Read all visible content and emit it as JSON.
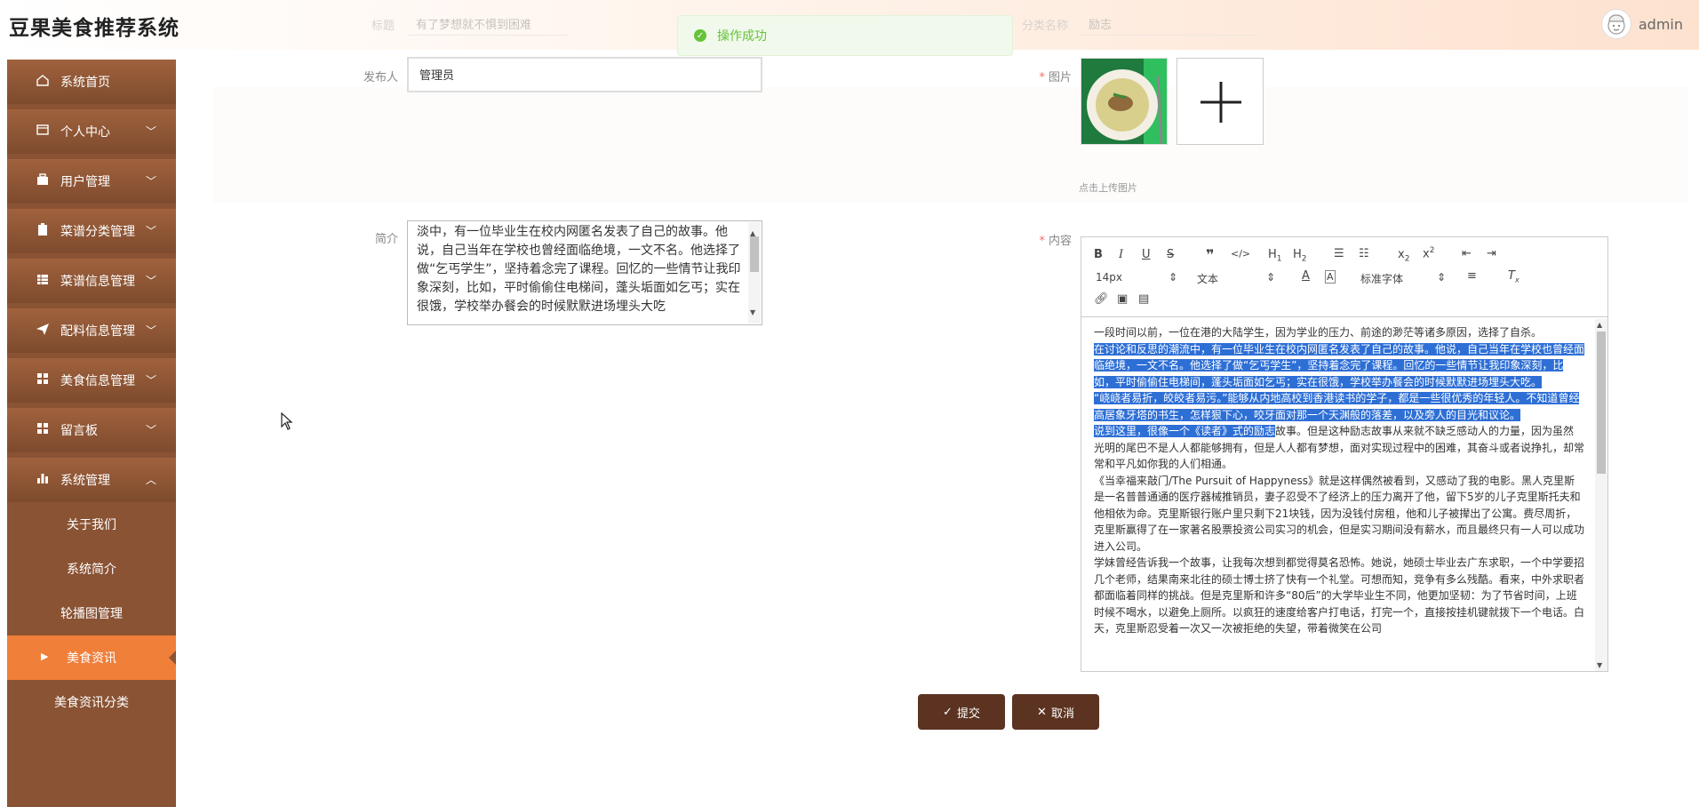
{
  "app": {
    "title": "豆果美食推荐系统"
  },
  "header": {
    "ghost_left_label": "标题",
    "ghost_left_value": "有了梦想就不惧到困难",
    "ghost_right_label": "分类名称",
    "ghost_right_value": "励志"
  },
  "user": {
    "name": "admin",
    "avatar_icon": "chef-avatar-icon"
  },
  "toast": {
    "text": "操作成功",
    "color": "#67c23a"
  },
  "sidebar": {
    "items": [
      {
        "label": "系统首页",
        "icon": "home-icon"
      },
      {
        "label": "个人中心",
        "icon": "wallet-icon"
      },
      {
        "label": "用户管理",
        "icon": "briefcase-icon"
      },
      {
        "label": "菜谱分类管理",
        "icon": "clipboard-icon"
      },
      {
        "label": "菜谱信息管理",
        "icon": "grid-icon"
      },
      {
        "label": "配料信息管理",
        "icon": "send-icon"
      },
      {
        "label": "美食信息管理",
        "icon": "dashboard-icon"
      },
      {
        "label": "留言板",
        "icon": "dashboard-icon"
      },
      {
        "label": "系统管理",
        "icon": "chart-icon"
      }
    ],
    "sub_items": [
      {
        "label": "关于我们"
      },
      {
        "label": "系统简介"
      },
      {
        "label": "轮播图管理"
      },
      {
        "label": "美食资讯"
      },
      {
        "label": "美食资讯分类"
      }
    ],
    "accent": "#f07f3a"
  },
  "form": {
    "publisher_label": "发布人",
    "publisher_value": "管理员",
    "image_label": "图片",
    "upload_tip": "点击上传图片",
    "intro_label": "简介",
    "intro_value": "淡中，有一位毕业生在校内网匿名发表了自己的故事。他说，自己当年在学校也曾经面临绝境，一文不名。他选择了做“乞丐学生”，坚持着念完了课程。回忆的一些情节让我印象深刻，比如，平时偷偷住电梯间，蓬头垢面如乞丐；实在很饿，学校举办餐会的时候默默进场埋头大吃",
    "content_label": "内容"
  },
  "editor": {
    "font_size": "14px",
    "para_type": "文本",
    "font_family": "标准字体",
    "lines": [
      {
        "text": "一段时间以前，一位在港的大陆学生，因为学业的压力、前途的渺茫等诸多原因，选择了自杀。",
        "hl": false
      },
      {
        "text": "在讨论和反思的潮流中，有一位毕业生在校内网匿名发表了自己的故事。他说，自己当年在学校也曾经面临绝境，一文不名。他选择了做“乞丐学生”，坚持着念完了课程。回忆的一些情节让我印象深刻，比如，平时偷偷住电梯间，蓬头垢面如乞丐；实在很饿，学校举办餐会的时候默默进场埋头大吃。",
        "hl": true
      },
      {
        "text": "“峣峣者易折，皎皎者易污。”能够从内地高校到香港读书的学子，都是一些很优秀的年轻人。不知道曾经高居象牙塔的书生，怎样狠下心，咬牙面对那一个天渊般的落差，以及旁人的目光和议论。",
        "hl": true
      },
      {
        "text_hl": "说到这里，很像一个《读者》式的励志",
        "text": "故事。但是这种励志故事从来就不缺乏感动人的力量，因为虽然光明的尾巴不是人人都能够拥有，但是人人都有梦想，面对实现过程中的困难，其奋斗或者说挣扎，却常常和平凡如你我的人们相通。",
        "split": true
      },
      {
        "text": "《当幸福来敲门/The Pursuit of Happyness》就是这样偶然被看到，又感动了我的电影。黑人克里斯是一名普普通通的医疗器械推销员，妻子忍受不了经济上的压力离开了他，留下5岁的儿子克里斯托夫和他相依为命。克里斯银行账户里只剩下21块钱，因为没钱付房租，他和儿子被撵出了公寓。费尽周折，克里斯赢得了在一家著名股票投资公司实习的机会，但是实习期间没有薪水，而且最终只有一人可以成功进入公司。",
        "hl": false
      },
      {
        "text": "学妹曾经告诉我一个故事，让我每次想到都觉得莫名恐怖。她说，她硕士毕业去广东求职，一个中学要招几个老师，结果南来北往的硕士博士挤了快有一个礼堂。可想而知，竞争有多么残酷。看来，中外求职者都面临着同样的挑战。但是克里斯和许多“80后”的大学毕业生不同，他更加坚韧：为了节省时间，上班时候不喝水，以避免上厕所。以疯狂的速度给客户打电话，打完一个，直接按挂机键就拨下一个电话。白天，克里斯忍受着一次又一次被拒绝的失望，带着微笑在公司",
        "hl": false
      }
    ]
  },
  "actions": {
    "submit": "提交",
    "cancel": "取消",
    "button_color": "#5b3320"
  }
}
